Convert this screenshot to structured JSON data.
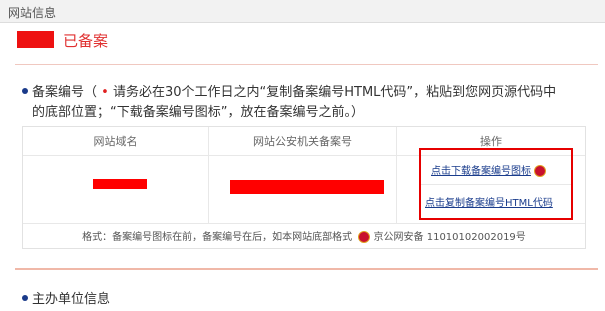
{
  "header": {
    "title": "网站信息"
  },
  "status": {
    "text": "已备案"
  },
  "record_section": {
    "title": "备案编号（",
    "notice_line1": "请务必在30个工作日之内“复制备案编号HTML代码”，粘贴到您网页源代码中",
    "notice_line2": "的底部位置；“下载备案编号图标”，放在备案编号之前。）"
  },
  "table": {
    "headers": [
      "网站域名",
      "网站公安机关备案号",
      "操作"
    ],
    "ops": {
      "download_icon_label": "点击下载备案编号图标",
      "copy_html_label": "点击复制备案编号HTML代码"
    },
    "footnote": "格式：备案编号图标在前，备案编号在后，如本网站底部格式",
    "footnote_example": "京公网安备 11010102002019号"
  },
  "organizer_section": {
    "title": "主办单位信息"
  },
  "colors": {
    "accent_red": "#e03030",
    "link_blue": "#1a3c8c",
    "highlight_box": "#e60000"
  }
}
